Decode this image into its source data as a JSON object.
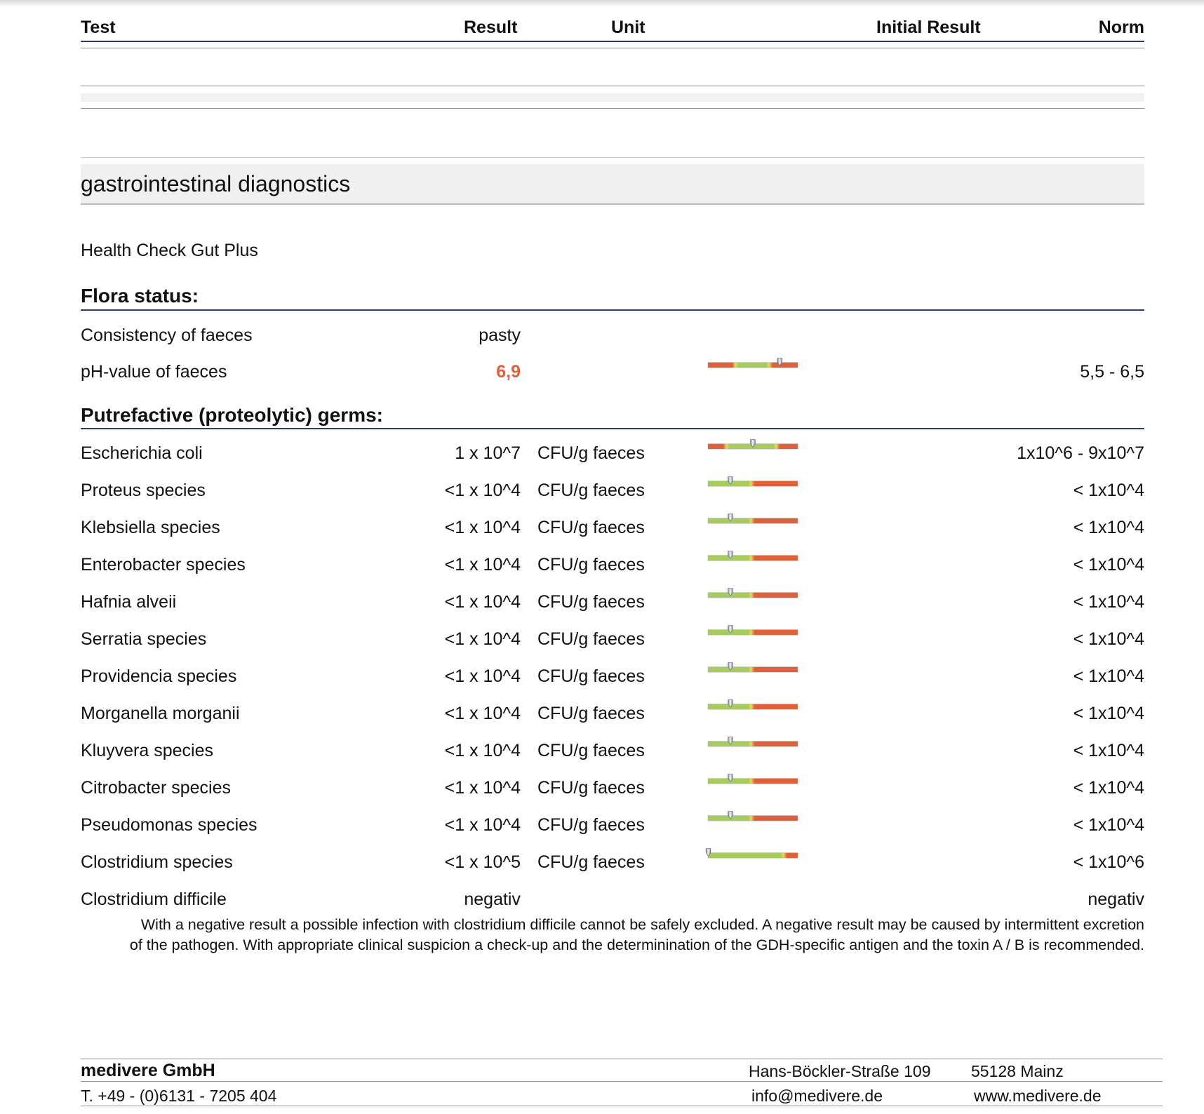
{
  "header": {
    "test": "Test",
    "result": "Result",
    "unit": "Unit",
    "initial_result": "Initial Result",
    "norm": "Norm"
  },
  "section": {
    "title": "gastrointestinal diagnostics",
    "subtitle": "Health Check Gut Plus"
  },
  "colors": {
    "rule_dark": "#2b3d66",
    "bar_red": "#e0603a",
    "bar_green": "#a6cc5e",
    "bar_yellow": "#e3dd55",
    "result_high": "#e0603a"
  },
  "flora": {
    "heading": "Flora status:",
    "rows": [
      {
        "name": "Consistency of faeces",
        "result": "pasty",
        "unit": "",
        "norm": ""
      },
      {
        "name": "pH-value of faeces",
        "result": "6,9",
        "unit": "",
        "norm": "5,5 - 6,5",
        "flag": "high",
        "gauge": {
          "scheme": "red-green-red",
          "low": 0.32,
          "high": 0.68,
          "marker": 0.8
        }
      }
    ]
  },
  "putrefactive": {
    "heading": "Putrefactive (proteolytic) germs:",
    "rows": [
      {
        "name": "Escherichia coli",
        "result": "1 x 10^7",
        "unit": "CFU/g faeces",
        "norm": "1x10^6 - 9x10^7",
        "gauge": {
          "scheme": "red-green-red",
          "low": 0.22,
          "high": 0.76,
          "marker": 0.5
        }
      },
      {
        "name": "Proteus species",
        "result": "<1 x 10^4",
        "unit": "CFU/g faeces",
        "norm": "< 1x10^4",
        "gauge": {
          "scheme": "green-red",
          "high": 0.5,
          "marker": 0.25
        }
      },
      {
        "name": "Klebsiella species",
        "result": "<1 x 10^4",
        "unit": "CFU/g faeces",
        "norm": "< 1x10^4",
        "gauge": {
          "scheme": "green-red",
          "high": 0.5,
          "marker": 0.25
        }
      },
      {
        "name": "Enterobacter species",
        "result": "<1 x 10^4",
        "unit": "CFU/g faeces",
        "norm": "< 1x10^4",
        "gauge": {
          "scheme": "green-red",
          "high": 0.5,
          "marker": 0.25
        }
      },
      {
        "name": "Hafnia alveii",
        "result": "<1 x 10^4",
        "unit": "CFU/g faeces",
        "norm": "< 1x10^4",
        "gauge": {
          "scheme": "green-red",
          "high": 0.5,
          "marker": 0.25
        }
      },
      {
        "name": "Serratia species",
        "result": "<1 x 10^4",
        "unit": "CFU/g faeces",
        "norm": "< 1x10^4",
        "gauge": {
          "scheme": "green-red",
          "high": 0.5,
          "marker": 0.25
        }
      },
      {
        "name": "Providencia species",
        "result": "<1 x 10^4",
        "unit": "CFU/g faeces",
        "norm": "< 1x10^4",
        "gauge": {
          "scheme": "green-red",
          "high": 0.5,
          "marker": 0.25
        }
      },
      {
        "name": "Morganella morganii",
        "result": "<1 x 10^4",
        "unit": "CFU/g faeces",
        "norm": "< 1x10^4",
        "gauge": {
          "scheme": "green-red",
          "high": 0.5,
          "marker": 0.25
        }
      },
      {
        "name": "Kluyvera species",
        "result": "<1 x 10^4",
        "unit": "CFU/g faeces",
        "norm": "< 1x10^4",
        "gauge": {
          "scheme": "green-red",
          "high": 0.5,
          "marker": 0.25
        }
      },
      {
        "name": "Citrobacter species",
        "result": "<1 x 10^4",
        "unit": "CFU/g faeces",
        "norm": "< 1x10^4",
        "gauge": {
          "scheme": "green-red",
          "high": 0.5,
          "marker": 0.25
        }
      },
      {
        "name": "Pseudomonas species",
        "result": "<1 x 10^4",
        "unit": "CFU/g faeces",
        "norm": "< 1x10^4",
        "gauge": {
          "scheme": "green-red",
          "high": 0.5,
          "marker": 0.25
        }
      },
      {
        "name": "Clostridium species",
        "result": "<1 x 10^5",
        "unit": "CFU/g faeces",
        "norm": "< 1x10^6",
        "gauge": {
          "scheme": "green-red",
          "high": 0.86,
          "marker": 0.0
        }
      },
      {
        "name": "Clostridium difficile",
        "result": "negativ",
        "unit": "",
        "norm": "negativ"
      }
    ]
  },
  "note": {
    "line1": "With a negative result a possible infection with clostridium difficile cannot be safely excluded. A negative result may be caused by intermittent excretion",
    "line2": "of the pathogen. With appropriate clinical suspicion a check-up and the determinination of the GDH-specific antigen and the toxin A / B is recommended."
  },
  "footer": {
    "company": "medivere GmbH",
    "street": "Hans-Böckler-Straße 109",
    "city": "55128 Mainz",
    "phone": "T. +49 - (0)6131 - 7205 404",
    "email": "info@medivere.de",
    "web": "www.medivere.de"
  }
}
